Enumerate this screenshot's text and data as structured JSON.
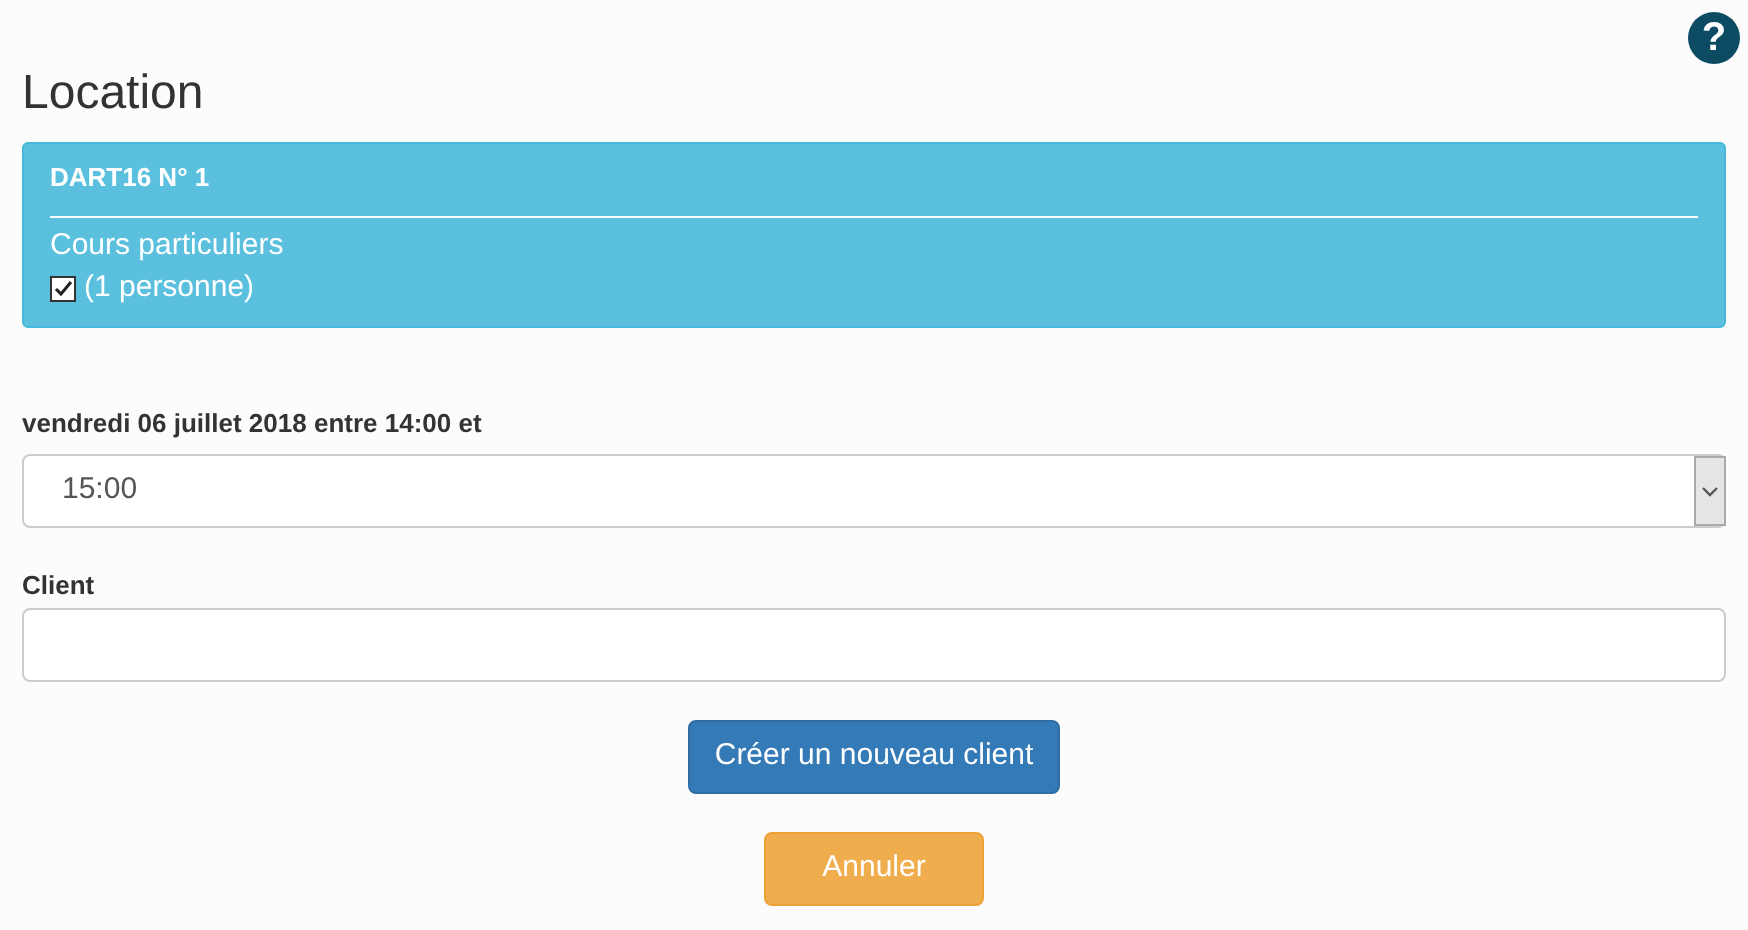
{
  "help": "?",
  "title": "Location",
  "panel": {
    "heading": "DART16 N° 1",
    "course": "Cours particuliers",
    "option": {
      "label": "(1 personne)",
      "checked": true
    }
  },
  "time_field": {
    "label": "vendredi 06 juillet 2018 entre 14:00 et",
    "value": "15:00"
  },
  "client_field": {
    "label": "Client"
  },
  "buttons": [
    {
      "label": "Créer un nouveau client",
      "kind": "primary"
    },
    {
      "label": "Annuler",
      "kind": "warning"
    }
  ]
}
